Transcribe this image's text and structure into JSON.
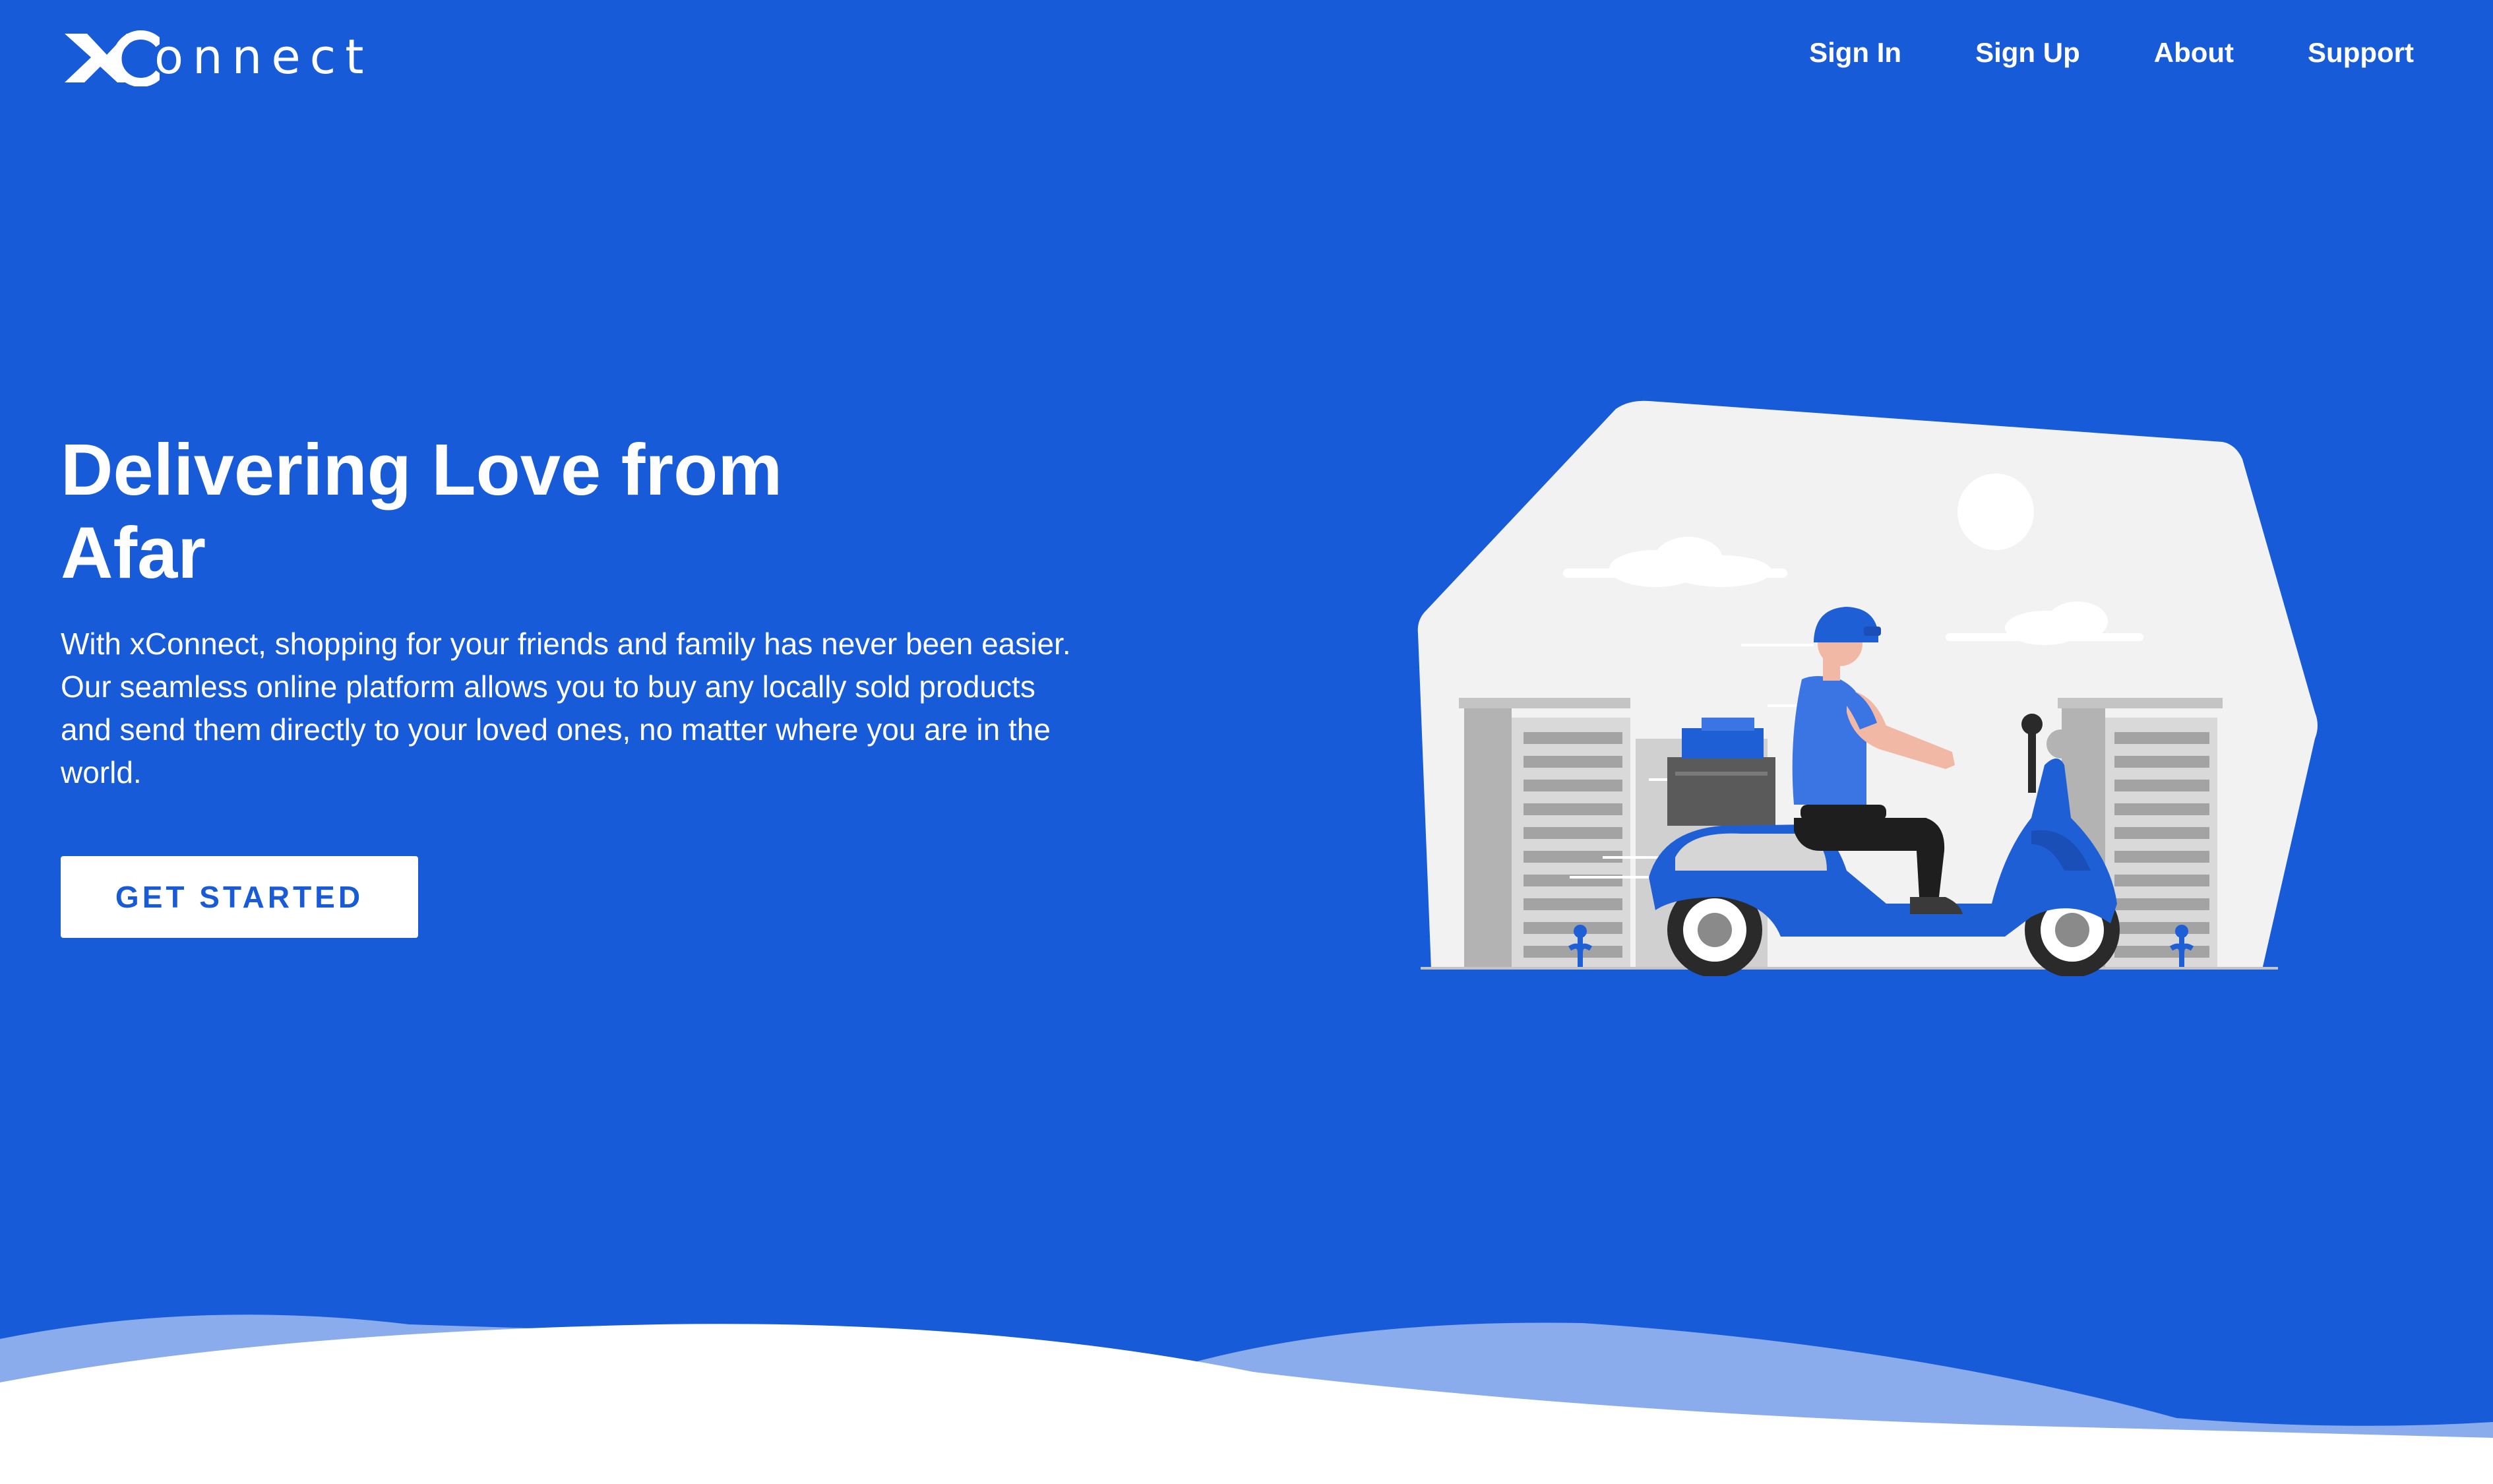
{
  "brand": {
    "logo_text": "onnect",
    "logo_icon": "xconnect-x-logo-icon"
  },
  "nav": {
    "items": [
      {
        "label": "Sign In"
      },
      {
        "label": "Sign Up"
      },
      {
        "label": "About"
      },
      {
        "label": "Support"
      }
    ]
  },
  "hero": {
    "title_line1": "Delivering Love from",
    "title_line2": "Afar",
    "description": "With xConnect, shopping for your friends and family has never been easier. Our seamless online platform allows you to buy any locally sold products and send them directly to your loved ones, no matter where you are in the world.",
    "cta_label": "GET STARTED"
  },
  "illustration": {
    "name": "delivery-scooter-illustration"
  },
  "colors": {
    "brand_blue": "#185bd8",
    "light_blue_wave": "#8aacec",
    "white": "#ffffff",
    "panel_gray": "#f2f2f2"
  }
}
